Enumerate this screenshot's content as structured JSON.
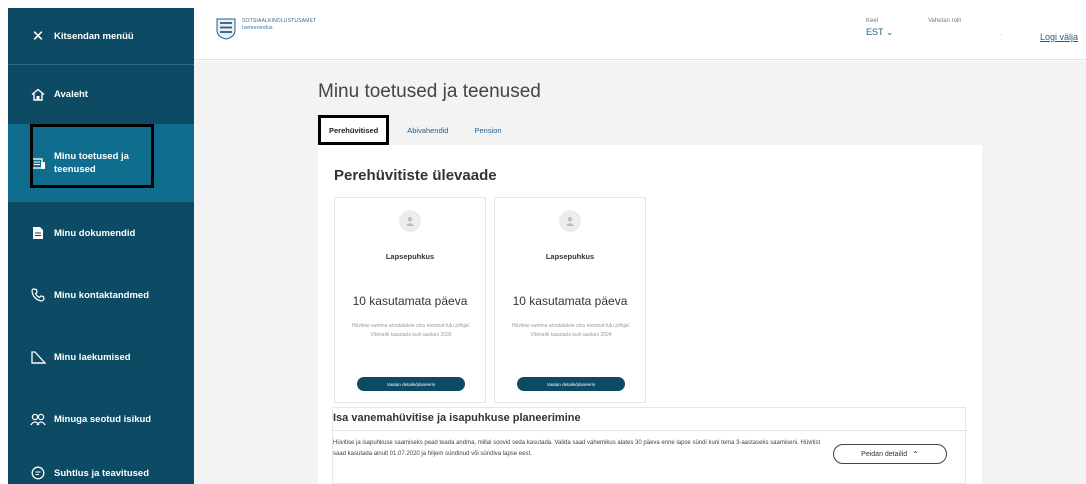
{
  "sidebar": {
    "close_label": "Kitsendan menüü",
    "items": [
      {
        "label": "Avaleht",
        "icon": "home-icon"
      },
      {
        "label": "Minu toetused ja teenused",
        "icon": "benefits-icon",
        "active": true
      },
      {
        "label": "Minu dokumendid",
        "icon": "document-icon"
      },
      {
        "label": "Minu kontaktandmed",
        "icon": "phone-icon"
      },
      {
        "label": "Minu laekumised",
        "icon": "payments-icon"
      },
      {
        "label": "Minuga seotud isikud",
        "icon": "people-icon"
      },
      {
        "label": "Suhtlus ja teavitused",
        "icon": "chat-icon"
      }
    ]
  },
  "header": {
    "logo_line1": "SOTSIAALKINDLUSTUSAMET",
    "logo_line2": "Iseteenindus",
    "lang_label": "Keel",
    "lang_value": "EST",
    "role_label": "Vahetan rolli",
    "role_value": "-",
    "logout_label": "Logi välja"
  },
  "main": {
    "title": "Minu toetused ja teenused",
    "tabs": [
      {
        "label": "Perehüvitised",
        "active": true
      },
      {
        "label": "Abivahendid"
      },
      {
        "label": "Pension"
      }
    ],
    "overview_title": "Perehüvitiste ülevaade",
    "cards": [
      {
        "title": "Lapsepuhkus",
        "days": "10 kasutamata päeva",
        "desc": "Hüvitise summa arvutatakse sinu teenitud tulu põhjal. Võimalik kasutada kuni aastani 2030",
        "button": "Vaatan detaile/planeerin"
      },
      {
        "title": "Lapsepuhkus",
        "days": "10 kasutamata päeva",
        "desc": "Hüvitise summa arvutatakse sinu teenitud tulu põhjal. Võimalik kasutada kuni aastani 2024",
        "button": "Vaatan detaile/planeerin"
      }
    ],
    "plan": {
      "title": "Isa vanemahüvitise ja isapuhkuse planeerimine",
      "text": "Hüvitise ja isapuhkuse saamiseks pead teada andma, millal soovid seda kasutada. Valida saad vahemikus alates 30 päeva enne lapse sündi kuni tema 3-aastaseks saamiseni. Hüvitist saad kasutada ainult 01.07.2020 ja hiljem sündinud või sündiva lapse eest.",
      "details_button": "Peidan detailid"
    }
  },
  "colors": {
    "sidebar_bg": "#0d4a63",
    "sidebar_active": "#0f6d8e",
    "link": "#1f5f8b",
    "background": "#f3f3f3"
  }
}
